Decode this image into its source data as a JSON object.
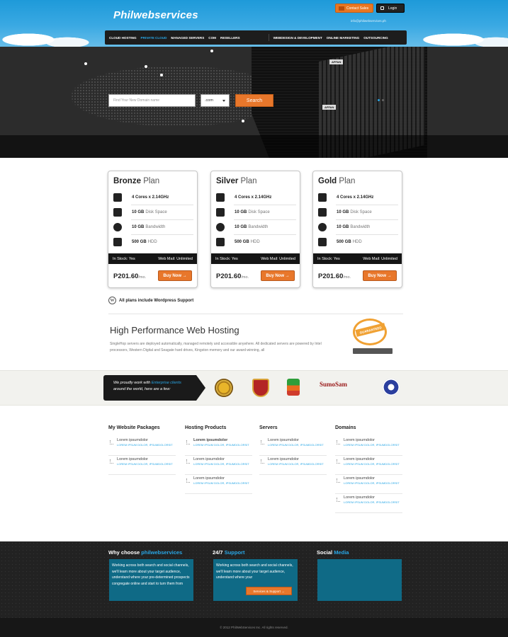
{
  "header": {
    "logo": "Philwebservices",
    "contact_label": "Contact Sales",
    "login_label": "Login",
    "email": "info@philwebservices.ph",
    "nav": [
      "CLOUD HOSTING",
      "PRIVATE CLOUD",
      "MANAGED SERVERS",
      "COM",
      "RESELLERS",
      "WEBDESIGN & DEVELOPMENT",
      "ONLINE MARKETING",
      "OUTSOURCING"
    ],
    "nav_active": "PRIVATE CLOUD"
  },
  "hero": {
    "server_tags": [
      "AFFAN",
      "AFFAN"
    ],
    "search_placeholder": "Find Your New Domain name",
    "tld_value": ".com",
    "search_label": "Search"
  },
  "plans": [
    {
      "name": "Bronze",
      "suffix": "Plan",
      "cores": "4 Cores x 2.14GHz",
      "disk": "10 GB",
      "disk_note": "Disk Space",
      "bw": "10 GB",
      "bw_note": "Bandwidth",
      "hdd": "500 GB",
      "hdd_note": "HDD",
      "stock": "In Stock: Yes",
      "mail": "Web Mail: Unlimited",
      "price": "P201.60",
      "per": "/mo.",
      "buy": "Buy Now →"
    },
    {
      "name": "Silver",
      "suffix": "Plan",
      "cores": "4 Cores x 2.14GHz",
      "disk": "10 GB",
      "disk_note": "Disk Space",
      "bw": "10 GB",
      "bw_note": "Bandwidth",
      "hdd": "500 GB",
      "hdd_note": "HDD",
      "stock": "In Stock: Yes",
      "mail": "Web Mail: Unlimited",
      "price": "P201.60",
      "per": "/mo.",
      "buy": "Buy Now →"
    },
    {
      "name": "Gold",
      "suffix": "Plan",
      "cores": "4 Cores x 2.14GHz",
      "disk": "10 GB",
      "disk_note": "Disk Space",
      "bw": "10 GB",
      "bw_note": "Bandwidth",
      "hdd": "500 GB",
      "hdd_note": "HDD",
      "stock": "In Stock: Yes",
      "mail": "Web Mail: Unlimited",
      "price": "P201.60",
      "per": "/mo.",
      "buy": "Buy Now →"
    }
  ],
  "wordpress_note": "All plans include Wordpress Support",
  "performance": {
    "title": "High Performance Web Hosting",
    "text": "SingleHop servers are deployed automatically, managed remotely and accessible anywhere. All dedicated servers are powered by Intel processors, Western Digital and Seagate hard drives, Kingston memory and our award-winning, all",
    "badge": "GUARANTEED"
  },
  "clients": {
    "text_a": "We proudly work with",
    "text_hl": "Enterprise clients",
    "text_b": "around the world, here are a few:",
    "sumo": "SumoSam"
  },
  "footer_links": [
    {
      "title": "My Website Packages",
      "items": [
        {
          "t": "Lorem ipsumdolor",
          "s": "LOREM IPSUM DOLOR, IPSUMDOLORSIT"
        },
        {
          "t": "Lorem ipsumdolor",
          "s": "LOREM IPSUM DOLOR, IPSUMDOLORSIT"
        }
      ]
    },
    {
      "title": "Hosting Products",
      "items": [
        {
          "t": "Lorem ipsumdolor",
          "s": "LOREM IPSUM DOLOR, IPSUMDOLORSIT"
        },
        {
          "t": "Lorem ipsumdolor",
          "s": "LOREM IPSUM DOLOR, IPSUMDOLORSIT"
        },
        {
          "t": "Lorem ipsumdolor",
          "s": "LOREM IPSUM DOLOR, IPSUMDOLORSIT"
        }
      ]
    },
    {
      "title": "Servers",
      "items": [
        {
          "t": "Lorem ipsumdolor",
          "s": "LOREM IPSUM DOLOR, IPSUMDOLORSIT"
        },
        {
          "t": "Lorem ipsumdolor",
          "s": "LOREM IPSUM DOLOR, IPSUMDOLORSIT"
        }
      ]
    },
    {
      "title": "Domains",
      "items": [
        {
          "t": "Lorem ipsumdolor",
          "s": "LOREM IPSUM DOLOR, IPSUMDOLORSIT"
        },
        {
          "t": "Lorem ipsumdolor",
          "s": "LOREM IPSUM DOLOR, IPSUMDOLORSIT"
        },
        {
          "t": "Lorem ipsumdolor",
          "s": "LOREM IPSUM DOLOR, IPSUMDOLORSIT"
        },
        {
          "t": "Lorem ipsumdolor",
          "s": "LOREM IPSUM DOLOR, IPSUMDOLORSIT"
        }
      ]
    }
  ],
  "bottom": {
    "why_a": "Why choose",
    "why_b": "philwebservices",
    "why_text": "Working across both search and social channels, we'll learn more about your target audience, understand where your pre-determined prospects congregate online and start to turn them from",
    "support_a": "24/7",
    "support_b": "Support",
    "support_text": "Working across both search and social channels, we'll learn more about your target audience, understand where your",
    "support_btn": "Services & Support →",
    "social_a": "Social",
    "social_b": "Media",
    "copyright": "© 2012 PhilWebServices Inc. All rights reserved."
  },
  "colors": {
    "accent_blue": "#29a7e6",
    "accent_orange": "#e8772b",
    "dark": "#222222",
    "teal": "#0f6a86"
  }
}
